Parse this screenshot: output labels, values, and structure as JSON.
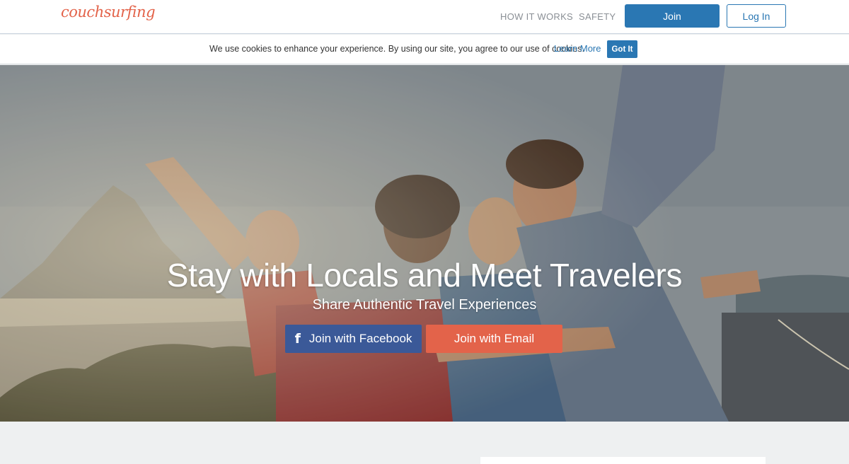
{
  "header": {
    "logo": "couchsurfing",
    "nav": {
      "how_it_works": "HOW IT WORKS",
      "safety": "SAFETY"
    },
    "join_label": "Join",
    "login_label": "Log In"
  },
  "cookie_bar": {
    "text": "We use cookies to enhance your experience. By using our site, you agree to our use of cookies.",
    "learn_more": "Learn More",
    "got_it": "Got It"
  },
  "hero": {
    "title": "Stay with Locals and Meet Travelers",
    "subtitle": "Share Authentic Travel Experiences",
    "facebook_label": "Join with Facebook",
    "facebook_icon": "f",
    "email_label": "Join with Email"
  },
  "colors": {
    "accent_blue": "#2a77b3",
    "brand_orange": "#e3634a",
    "facebook_blue": "#3b5998"
  }
}
